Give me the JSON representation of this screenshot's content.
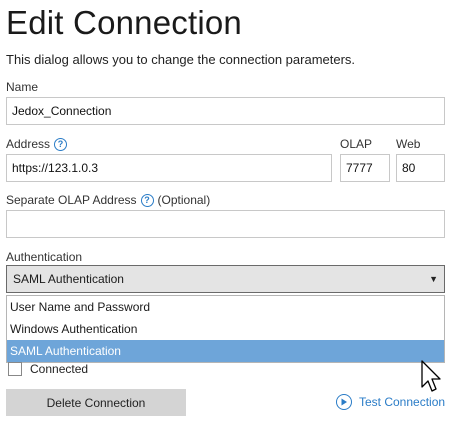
{
  "dialog": {
    "title": "Edit Connection",
    "subtitle": "This dialog allows you to change the connection parameters."
  },
  "name": {
    "label": "Name",
    "value": "Jedox_Connection"
  },
  "address": {
    "label": "Address",
    "value": "https://123.1.0.3"
  },
  "olap": {
    "label": "OLAP",
    "value": "7777"
  },
  "web": {
    "label": "Web",
    "value": "80"
  },
  "separate_olap": {
    "label": "Separate OLAP Address",
    "optional": "(Optional)",
    "value": ""
  },
  "authentication": {
    "label": "Authentication",
    "selected": "SAML Authentication",
    "options": [
      "User Name and Password",
      "Windows Authentication",
      "SAML Authentication"
    ]
  },
  "connected": {
    "label": "Connected",
    "checked": false
  },
  "buttons": {
    "delete": "Delete Connection",
    "test": "Test Connection"
  },
  "icons": {
    "help": "help-icon",
    "play": "play-circle-icon",
    "caret": "chevron-down-icon",
    "cursor": "mouse-pointer-icon"
  },
  "colors": {
    "accent": "#2a7cc7",
    "selected_option": "#6ea5d9"
  }
}
